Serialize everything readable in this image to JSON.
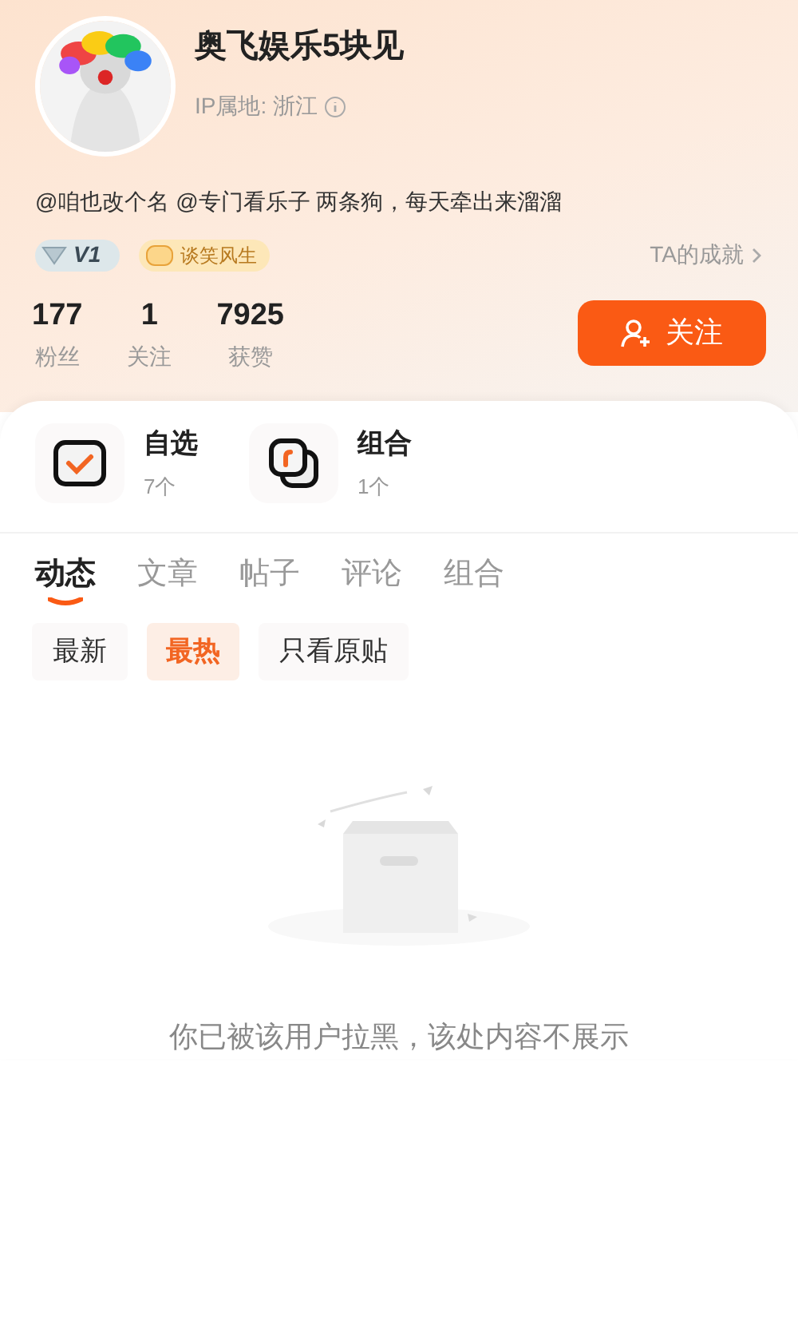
{
  "profile": {
    "name": "奥飞娱乐5块见",
    "ip_location": "IP属地: 浙江",
    "bio": "@咱也改个名 @专门看乐子 两条狗，每天牵出来溜溜"
  },
  "badges": [
    {
      "kind": "level",
      "label": "V1"
    },
    {
      "kind": "medal",
      "label": "谈笑风生"
    }
  ],
  "achievements_link": "TA的成就",
  "stats": [
    {
      "value": "177",
      "label": "粉丝"
    },
    {
      "value": "1",
      "label": "关注"
    },
    {
      "value": "7925",
      "label": "获赞"
    }
  ],
  "follow_button": "关注",
  "collections": [
    {
      "kind": "watchlist",
      "title": "自选",
      "count": "7个"
    },
    {
      "kind": "portfolio",
      "title": "组合",
      "count": "1个"
    }
  ],
  "tabs": [
    {
      "label": "动态",
      "selected": true
    },
    {
      "label": "文章",
      "selected": false
    },
    {
      "label": "帖子",
      "selected": false
    },
    {
      "label": "评论",
      "selected": false
    },
    {
      "label": "组合",
      "selected": false
    }
  ],
  "filters": [
    {
      "label": "最新",
      "selected": false
    },
    {
      "label": "最热",
      "selected": true
    },
    {
      "label": "只看原贴",
      "selected": false
    }
  ],
  "empty_state": {
    "message": "你已被该用户拉黑，该处内容不展示"
  }
}
